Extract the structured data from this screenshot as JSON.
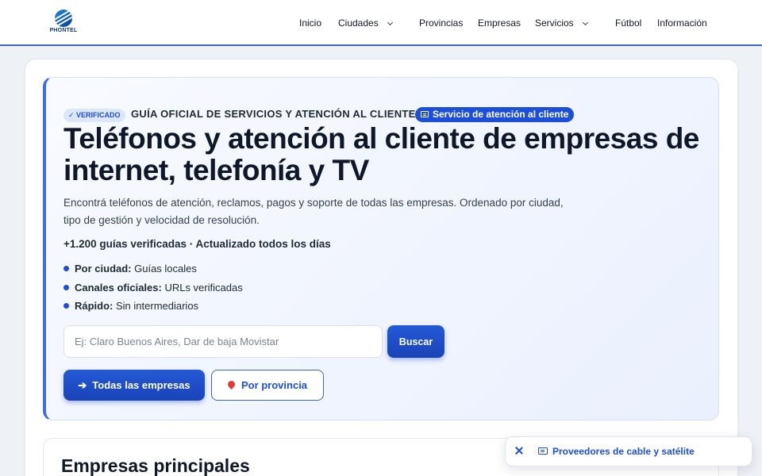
{
  "header": {
    "logo_text": "PHONTEL",
    "nav": [
      {
        "label": "Inicio"
      },
      {
        "label": "Ciudades"
      },
      {
        "label": "Provincias"
      },
      {
        "label": "Empresas"
      },
      {
        "label": "Servicios"
      },
      {
        "label": "Fútbol"
      },
      {
        "label": "Información"
      }
    ]
  },
  "hero": {
    "badge": "✓ VERIFICADO",
    "eyebrow": "GUÍA OFICIAL DE SERVICIOS Y ATENCIÓN AL CLIENTE",
    "service_pill": "Servicio de atención al cliente",
    "title": "Teléfonos y atención al cliente de empresas de internet, telefonía y TV",
    "description": "Encontrá teléfonos de atención, reclamos, pagos y soporte de todas las empresas. Ordenado por ciudad, tipo de gestión y velocidad de resolución.",
    "stats": "+1.200 guías verificadas · Actualizado todos los días",
    "features": [
      {
        "bold": "Por ciudad:",
        "text": " Guías locales"
      },
      {
        "bold": "Canales oficiales:",
        "text": " URLs verificadas"
      },
      {
        "bold": "Rápido:",
        "text": " Sin intermediarios"
      }
    ],
    "search": {
      "placeholder": "Ej: Claro Buenos Aires, Dar de baja Movistar",
      "value": "",
      "button": "Buscar"
    },
    "btn_all": "Todas las empresas",
    "btn_province": "Por provincia"
  },
  "section": {
    "title": "Empresas principales"
  },
  "toast": {
    "text": "Proveedores de cable y satélite"
  },
  "colors": {
    "accent": "#1d4ed8",
    "header_border": "#3b66c4",
    "background": "#eef1f6"
  }
}
